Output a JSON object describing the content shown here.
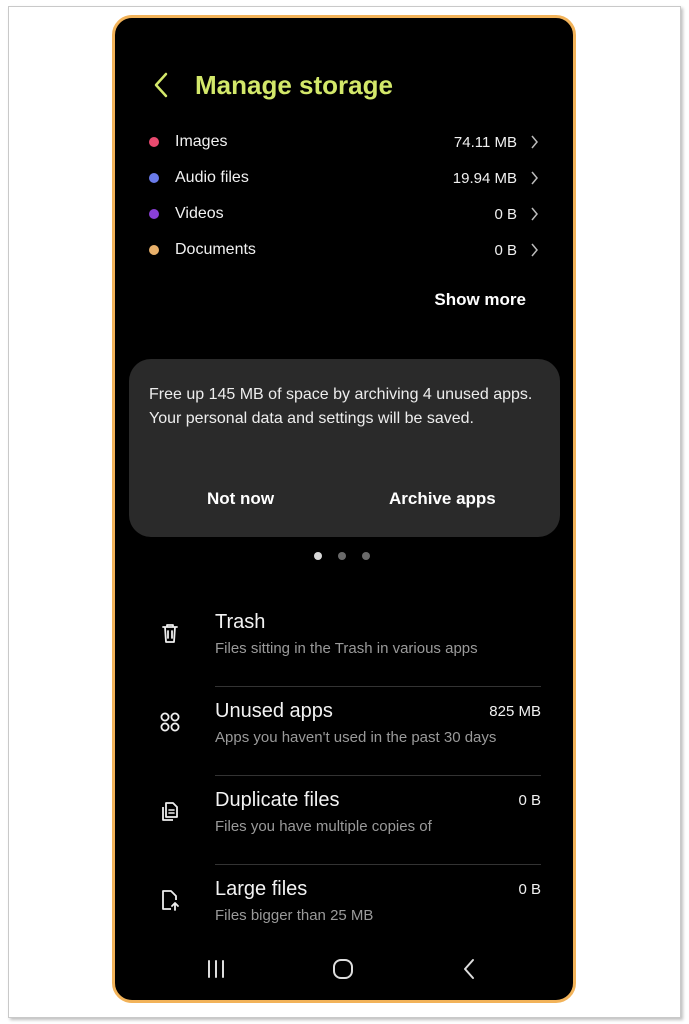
{
  "header": {
    "title": "Manage storage"
  },
  "categories": [
    {
      "label": "Images",
      "size": "74.11 MB",
      "color": "#e94a6f"
    },
    {
      "label": "Audio files",
      "size": "19.94 MB",
      "color": "#6a7bea"
    },
    {
      "label": "Videos",
      "size": "0 B",
      "color": "#8a3fd6"
    },
    {
      "label": "Documents",
      "size": "0 B",
      "color": "#e8b06a"
    }
  ],
  "show_more": "Show more",
  "archive_card": {
    "text": "Free up 145 MB of space by archiving 4 unused apps. Your personal data and settings will be saved.",
    "not_now": "Not now",
    "archive": "Archive apps"
  },
  "pager": {
    "count": 3,
    "active": 1
  },
  "items": [
    {
      "icon": "trash-icon",
      "title": "Trash",
      "subtitle": "Files sitting in the Trash in various apps",
      "size": ""
    },
    {
      "icon": "apps-icon",
      "title": "Unused apps",
      "subtitle": "Apps you haven't used in the past 30 days",
      "size": "825 MB"
    },
    {
      "icon": "duplicate-files-icon",
      "title": "Duplicate files",
      "subtitle": "Files you have multiple copies of",
      "size": "0 B"
    },
    {
      "icon": "large-file-icon",
      "title": "Large files",
      "subtitle": "Files bigger than 25 MB",
      "size": "0 B"
    }
  ],
  "nav": {
    "icons": [
      "recents-icon",
      "home-icon",
      "back-nav-icon"
    ]
  }
}
